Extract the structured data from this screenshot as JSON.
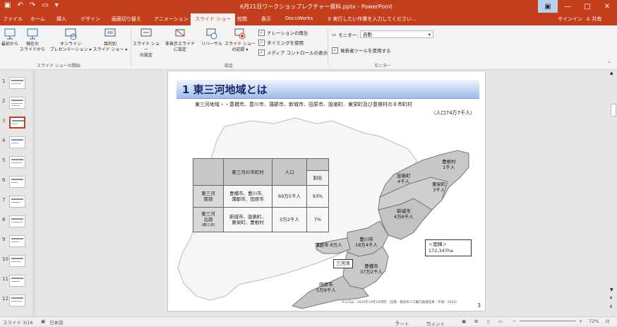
{
  "window": {
    "title": "6月21日ワークショップレクチャー資料.pptx - PowerPoint"
  },
  "tabs": [
    "ファイル",
    "ホーム",
    "挿入",
    "デザイン",
    "画面切り替え",
    "アニメーション",
    "スライド ショー",
    "校閲",
    "表示",
    "DocuWorks"
  ],
  "active_tab": "スライド ショー",
  "tell_me": "実行したい作業を入力してください...",
  "signin": "サインイン",
  "share": "共有",
  "ribbon": {
    "start": {
      "from_beginning": "最初から",
      "from_current": [
        "現在の",
        "スライドから"
      ],
      "online": [
        "オンライン",
        "プレゼンテーション ▾"
      ],
      "custom": [
        "目的別",
        "スライド ショー ▾"
      ],
      "label": "スライド ショーの開始"
    },
    "setup": {
      "setup_show": [
        "スライド ショー",
        "の設定"
      ],
      "hide_slide": [
        "非表示スライド",
        "に設定"
      ],
      "rehearse": "リハーサル",
      "record": [
        "スライド ショー",
        "の記録 ▾"
      ],
      "play_narrations": "ナレーションの再生",
      "use_timings": "タイミングを使用",
      "show_media_controls": "メディア コントロールの表示",
      "label": "設定"
    },
    "monitors": {
      "monitor_label": "モニター:",
      "monitor_value": "自動",
      "presenter_view": "発表者ツールを使用する",
      "label": "モニター"
    }
  },
  "thumbnails": [
    "1",
    "2",
    "3",
    "4",
    "5",
    "6",
    "7",
    "8",
    "9",
    "10",
    "11",
    "12"
  ],
  "active_slide": 3,
  "slide": {
    "title": "1 東三河地域とは",
    "subtitle": "東三河地域・・豊橋市、豊川市、蒲郡市、新城市、田原市、設楽町、東栄町及び豊根村の８市町村",
    "population_total": "（人口74万7千人）",
    "table": {
      "header": {
        "area": "東三河の市町村",
        "pop": "人口",
        "ratio": "割合"
      },
      "rows": [
        {
          "region": [
            "東三河",
            "南部"
          ],
          "cities": [
            "豊橋市、豊川市、",
            "蒲郡市、田原市"
          ],
          "pop": "69万5千人",
          "ratio": "93%"
        },
        {
          "region": [
            "東三河",
            "北部",
            "(奥三河)"
          ],
          "cities": [
            "新城市、設楽町、",
            "東栄町、豊根村"
          ],
          "pop": "5万2千人",
          "ratio": "7%"
        }
      ]
    },
    "map_labels": {
      "toyone": [
        "豊根村",
        "1千人"
      ],
      "shitara": [
        "設楽町",
        "4千人"
      ],
      "toei": [
        "東栄町",
        "3千人"
      ],
      "shinshiro": [
        "新城市",
        "4万6千人"
      ],
      "toyokawa": [
        "豊川市",
        "18万4千人"
      ],
      "gamagori": "蒲郡市 8万人",
      "toyohashi": [
        "豊橋市",
        "37万2千人"
      ],
      "tahara": [
        "田原市",
        "5万9千人"
      ],
      "mikawa_bay": "三河湾"
    },
    "area_box": [
      "＜面積＞",
      "172,347ha"
    ],
    "footnote": "※人口は、2020年10月1日現在（出典：愛知県人口動向調査結果｜年報｜2020）",
    "page_number": "3"
  },
  "status": {
    "slide_info": "スライド 3/16",
    "language": "日本語",
    "notes": "ノート",
    "comments": "コメント",
    "zoom": "72%"
  },
  "colors": {
    "accent": "#c43e1c",
    "map_fill": "#c8c8c8",
    "title_gradient_end": "#9fbde8"
  }
}
